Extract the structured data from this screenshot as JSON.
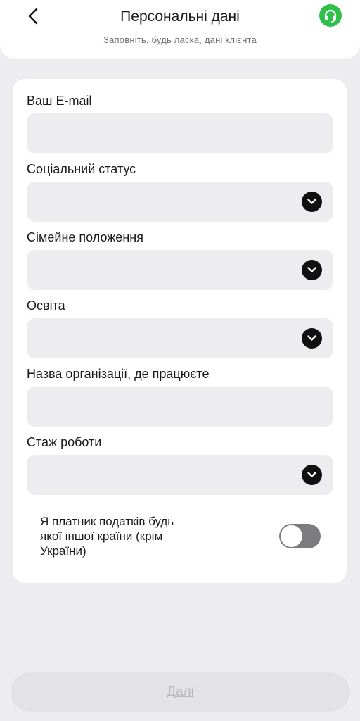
{
  "header": {
    "title": "Персональні дані",
    "subtitle": "Заповніть, будь ласка, дані клієнта",
    "support_color": "#2fbf4a"
  },
  "form": {
    "email": {
      "label": "Ваш E-mail",
      "value": "",
      "placeholder": ""
    },
    "social_status": {
      "label": "Соціальний статус",
      "value": ""
    },
    "marital_status": {
      "label": "Сімейне положення",
      "value": ""
    },
    "education": {
      "label": "Освіта",
      "value": ""
    },
    "organization": {
      "label": "Назва організації, де працюєте",
      "value": "",
      "placeholder": ""
    },
    "experience": {
      "label": "Стаж роботи",
      "value": ""
    },
    "tax_resident": {
      "label": "Я платник податків будь якої іншої країни (крім України)",
      "checked": false
    }
  },
  "footer": {
    "next_label": "Далі"
  }
}
